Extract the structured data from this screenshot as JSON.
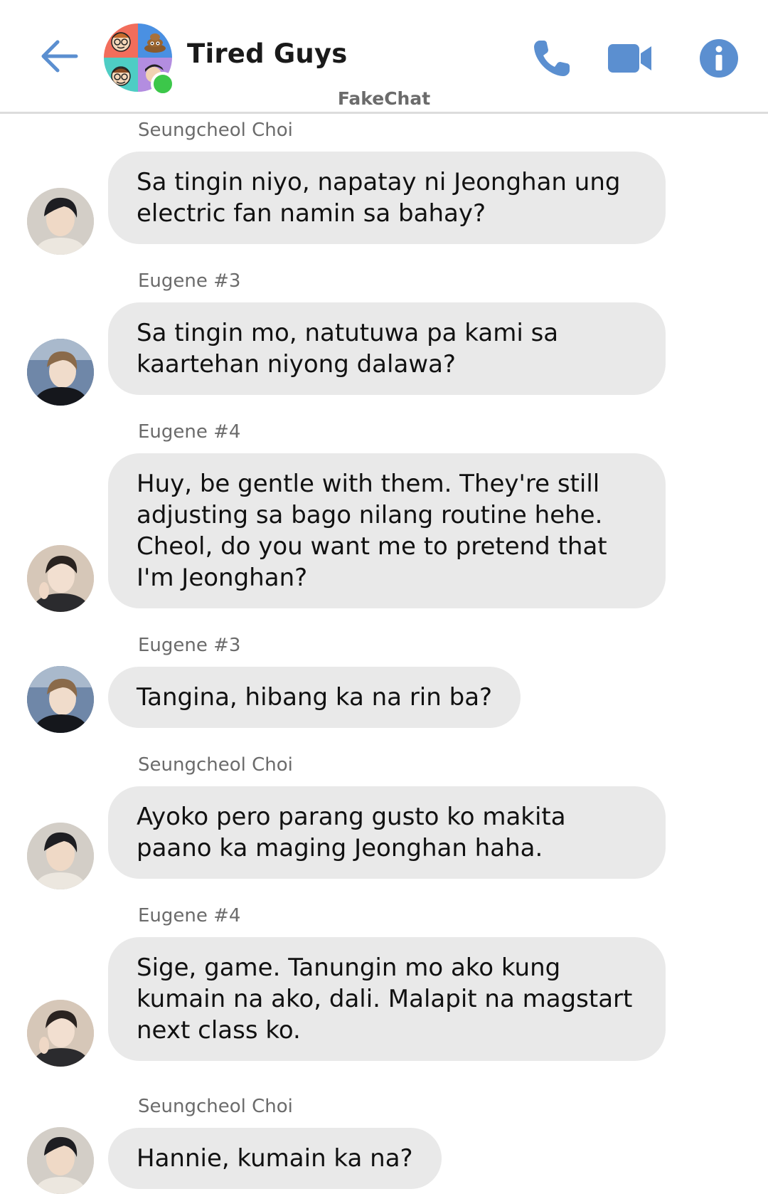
{
  "header": {
    "title": "Tired Guys",
    "app_name": "FakeChat",
    "online": true,
    "accent_color": "#5b8fd0"
  },
  "icons": {
    "back": "back-arrow-icon",
    "phone": "phone-icon",
    "video": "video-camera-icon",
    "info": "info-icon"
  },
  "messages": [
    {
      "sender": "Seungcheol Choi",
      "avatar": "seungcheol",
      "text": "Sa tingin niyo, napatay ni Jeonghan ung electric fan namin sa bahay?"
    },
    {
      "sender": "Eugene #3",
      "avatar": "eugene3",
      "text": "Sa tingin mo, natutuwa pa kami sa kaartehan niyong dalawa?"
    },
    {
      "sender": "Eugene #4",
      "avatar": "eugene4",
      "text": "Huy, be gentle with them. They're still adjusting sa bago nilang routine hehe. Cheol, do you want me to pretend that I'm Jeonghan?"
    },
    {
      "sender": "Eugene #3",
      "avatar": "eugene3",
      "text": "Tangina, hibang ka na rin ba?"
    },
    {
      "sender": "Seungcheol Choi",
      "avatar": "seungcheol",
      "text": "Ayoko pero parang gusto ko makita paano ka maging Jeonghan haha."
    },
    {
      "sender": "Eugene #4",
      "avatar": "eugene4",
      "text": "Sige, game. Tanungin mo ako kung kumain na ako, dali. Malapit na magstart next class ko."
    },
    {
      "sender": "Seungcheol Choi",
      "avatar": "seungcheol",
      "text": "Hannie, kumain ka na?"
    }
  ]
}
